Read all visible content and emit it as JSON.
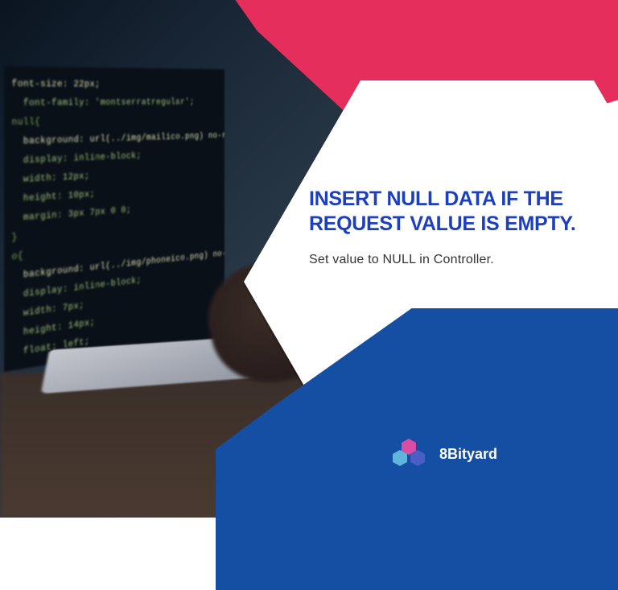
{
  "headline": "INSERT NULL DATA IF THE REQUEST VALUE IS EMPTY.",
  "subtitle": "Set value to NULL in Controller.",
  "brand": {
    "name": "8Bityard"
  },
  "colors": {
    "pink": "#e62e5c",
    "blue": "#154fa3",
    "headline_color": "#1b3fbf"
  },
  "code_preview_lines": [
    "font-size: 22px;",
    "  font-family: 'montserratregular';",
    "null{",
    "  background: url(../img/mailico.png) no-repeat center;",
    "  display: inline-block;",
    "  width: 12px;",
    "  height: 10px;",
    "  margin: 3px 7px 0 0;",
    "}",
    "o{",
    "  background: url(../img/phoneico.png) no-repeat center;",
    "  display: inline-block;",
    "  width: 7px;",
    "  height: 14px;",
    "  float: left;"
  ]
}
